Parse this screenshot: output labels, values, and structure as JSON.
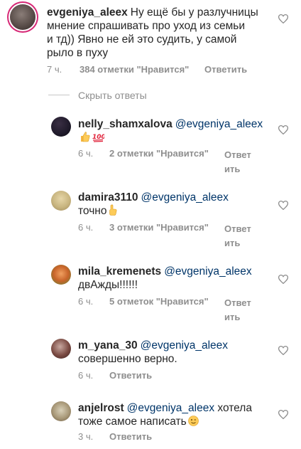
{
  "top_comment": {
    "username": "evgeniya_aleex",
    "text": "Ну ещё бы у разлучницы мнение спрашивать про уход из семьи и тд)) Явно не ей это судить, у самой рыло в пуху",
    "lines": [
      "Ну ещё бы у разлучницы",
      "мнение спрашивать про уход из семьи",
      "и тд)) Явно не ей это судить, у самой",
      "рыло в пуху"
    ],
    "time": "7 ч.",
    "likes": "384 отметки \"Нравится\"",
    "reply": "Ответить"
  },
  "hide_replies": "Скрыть ответы",
  "replies": [
    {
      "username": "nelly_shamxalova",
      "mention": "@evgeniya_aleex",
      "text": "",
      "emoji": [
        "thumbs-up",
        "hundred-points"
      ],
      "time": "6 ч.",
      "likes": "2 отметки \"Нравится\"",
      "reply_line1": "Ответ",
      "reply_line2": "ить"
    },
    {
      "username": "damira3110",
      "mention": "@evgeniya_aleex",
      "text": "точно",
      "emoji": [
        "pointing-up"
      ],
      "time": "6 ч.",
      "likes": "3 отметки \"Нравится\"",
      "reply_line1": "Ответ",
      "reply_line2": "ить"
    },
    {
      "username": "mila_kremenets",
      "mention": "@evgeniya_aleex",
      "text": "двАжды!!!!!!",
      "time": "6 ч.",
      "likes": "5 отметок \"Нравится\"",
      "reply_line1": "Ответ",
      "reply_line2": "ить"
    },
    {
      "username": "m_yana_30",
      "mention": "@evgeniya_aleex",
      "text": "совершенно верно.",
      "time": "6 ч.",
      "likes": "",
      "reply": "Ответить"
    },
    {
      "username": "anjelrost",
      "mention": "@evgeniya_aleex",
      "text_part1": "хотела",
      "text_part2": "тоже самое написать",
      "emoji": [
        "winking-face"
      ],
      "time": "3 ч.",
      "likes": "",
      "reply": "Ответить"
    }
  ],
  "colors": {
    "text": "#262626",
    "secondary": "#8e8e8e",
    "mention": "#003569",
    "story_ring": "#d62976"
  },
  "icons": [
    "heart-icon"
  ]
}
